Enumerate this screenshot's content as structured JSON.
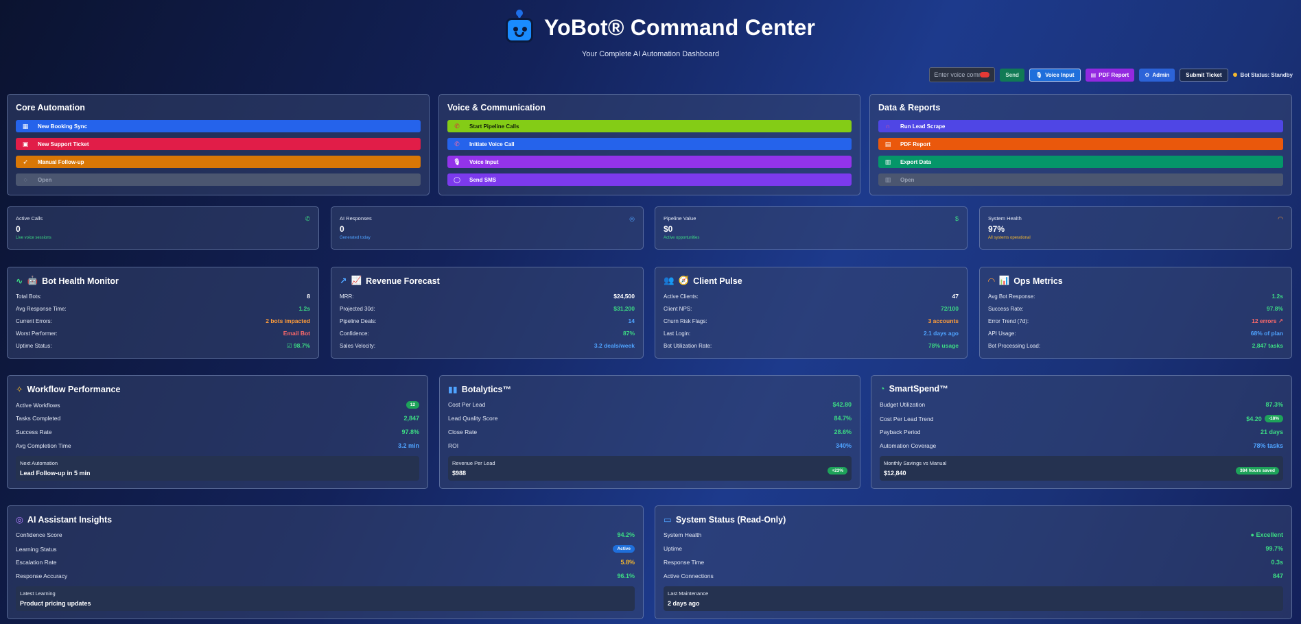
{
  "header": {
    "title": "YoBot® Command Center",
    "subtitle": "Your Complete AI Automation Dashboard"
  },
  "toolbar": {
    "voice_placeholder": "Enter voice command...",
    "send": "Send",
    "voice_input": "Voice Input",
    "pdf_report": "PDF Report",
    "admin": "Admin",
    "submit_ticket": "Submit Ticket",
    "bot_status": "Bot Status: Standby"
  },
  "panels": {
    "core": {
      "title": "Core Automation",
      "buttons": [
        "New Booking Sync",
        "New Support Ticket",
        "Manual Follow-up",
        "Open"
      ]
    },
    "voice": {
      "title": "Voice & Communication",
      "buttons": [
        "Start Pipeline Calls",
        "Initiate Voice Call",
        "Voice Input",
        "Send SMS"
      ]
    },
    "data": {
      "title": "Data & Reports",
      "buttons": [
        "Run Lead Scrape",
        "PDF Report",
        "Export Data",
        "Open"
      ]
    }
  },
  "stats": [
    {
      "label": "Active Calls",
      "value": "0",
      "sub": "Live voice sessions"
    },
    {
      "label": "AI Responses",
      "value": "0",
      "sub": "Generated today"
    },
    {
      "label": "Pipeline Value",
      "value": "$0",
      "sub": "Active opportunities"
    },
    {
      "label": "System Health",
      "value": "97%",
      "sub": "All systems operational"
    }
  ],
  "bot_health": {
    "title": "Bot Health Monitor",
    "rows": [
      {
        "k": "Total Bots:",
        "v": "8"
      },
      {
        "k": "Avg Response Time:",
        "v": "1.2s"
      },
      {
        "k": "Current Errors:",
        "v": "2 bots impacted"
      },
      {
        "k": "Worst Performer:",
        "v": "Email Bot"
      },
      {
        "k": "Uptime Status:",
        "v": "98.7%"
      }
    ]
  },
  "revenue": {
    "title": "Revenue Forecast",
    "rows": [
      {
        "k": "MRR:",
        "v": "$24,500"
      },
      {
        "k": "Projected 30d:",
        "v": "$31,200"
      },
      {
        "k": "Pipeline Deals:",
        "v": "14"
      },
      {
        "k": "Confidence:",
        "v": "87%"
      },
      {
        "k": "Sales Velocity:",
        "v": "3.2 deals/week"
      }
    ]
  },
  "client_pulse": {
    "title": "Client Pulse",
    "rows": [
      {
        "k": "Active Clients:",
        "v": "47"
      },
      {
        "k": "Client NPS:",
        "v": "72/100"
      },
      {
        "k": "Churn Risk Flags:",
        "v": "3 accounts"
      },
      {
        "k": "Last Login:",
        "v": "2.1 days ago"
      },
      {
        "k": "Bot Utilization Rate:",
        "v": "78% usage"
      }
    ]
  },
  "ops": {
    "title": "Ops Metrics",
    "rows": [
      {
        "k": "Avg Bot Response:",
        "v": "1.2s"
      },
      {
        "k": "Success Rate:",
        "v": "97.8%"
      },
      {
        "k": "Error Trend (7d):",
        "v": "12 errors ↗"
      },
      {
        "k": "API Usage:",
        "v": "68% of plan"
      },
      {
        "k": "Bot Processing Load:",
        "v": "2,847 tasks"
      }
    ]
  },
  "workflow": {
    "title": "Workflow Performance",
    "rows": [
      {
        "k": "Active Workflows",
        "v": "12"
      },
      {
        "k": "Tasks Completed",
        "v": "2,847"
      },
      {
        "k": "Success Rate",
        "v": "97.8%"
      },
      {
        "k": "Avg Completion Time",
        "v": "3.2 min"
      }
    ],
    "box_label": "Next Automation",
    "box_value": "Lead Follow-up in 5 min"
  },
  "botalytics": {
    "title": "Botalytics™",
    "rows": [
      {
        "k": "Cost Per Lead",
        "v": "$42.80"
      },
      {
        "k": "Lead Quality Score",
        "v": "84.7%"
      },
      {
        "k": "Close Rate",
        "v": "28.6%"
      },
      {
        "k": "ROI",
        "v": "340%"
      }
    ],
    "box_label": "Revenue Per Lead",
    "box_value": "$988",
    "box_badge": "+23%"
  },
  "smartspend": {
    "title": "SmartSpend™",
    "rows": [
      {
        "k": "Budget Utilization",
        "v": "87.3%"
      },
      {
        "k": "Cost Per Lead Trend",
        "v": "$4.20",
        "badge": "-18%"
      },
      {
        "k": "Payback Period",
        "v": "21 days"
      },
      {
        "k": "Automation Coverage",
        "v": "78% tasks"
      }
    ],
    "box_label": "Monthly Savings vs Manual",
    "box_value": "$12,840",
    "box_badge": "384 hours saved"
  },
  "ai_insights": {
    "title": "AI Assistant Insights",
    "rows": [
      {
        "k": "Confidence Score",
        "v": "94.2%"
      },
      {
        "k": "Learning Status",
        "v": "Active"
      },
      {
        "k": "Escalation Rate",
        "v": "5.8%"
      },
      {
        "k": "Response Accuracy",
        "v": "96.1%"
      }
    ],
    "box_label": "Latest Learning",
    "box_value": "Product pricing updates"
  },
  "system_status": {
    "title": "System Status (Read-Only)",
    "rows": [
      {
        "k": "System Health",
        "v": "Excellent"
      },
      {
        "k": "Uptime",
        "v": "99.7%"
      },
      {
        "k": "Response Time",
        "v": "0.3s"
      },
      {
        "k": "Active Connections",
        "v": "847"
      }
    ],
    "box_label": "Last Maintenance",
    "box_value": "2 days ago"
  },
  "colors": {
    "blue_button": "#2563eb",
    "red_button": "#e11d48",
    "orange_button": "#d97706",
    "lime_button": "#84cc16",
    "purple_button": "#9333ea",
    "violet_button": "#7c3aed",
    "indigo_button": "#4f46e5",
    "deep_orange_button": "#ea580c",
    "emerald_button": "#059669"
  }
}
